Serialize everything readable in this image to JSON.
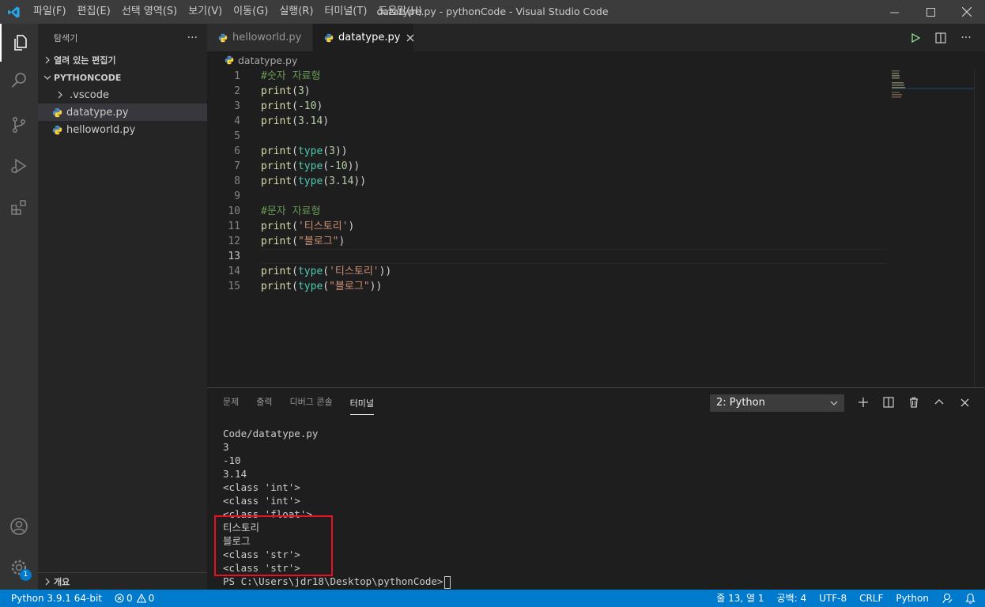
{
  "window": {
    "title": "datatype.py - pythonCode - Visual Studio Code"
  },
  "menu": [
    "파일(F)",
    "편집(E)",
    "선택 영역(S)",
    "보기(V)",
    "이동(G)",
    "실행(R)",
    "터미널(T)",
    "도움말(H)"
  ],
  "sidebar": {
    "title": "탐색기",
    "more": "···",
    "open_editors": "열려 있는 편집기",
    "folder": "PYTHONCODE",
    "items": [
      {
        "label": ".vscode",
        "type": "folder"
      },
      {
        "label": "datatype.py",
        "type": "python",
        "selected": true
      },
      {
        "label": "helloworld.py",
        "type": "python"
      }
    ],
    "outline": "개요"
  },
  "tabs": [
    {
      "label": "helloworld.py",
      "active": false
    },
    {
      "label": "datatype.py",
      "active": true
    }
  ],
  "breadcrumb": "datatype.py",
  "editor": {
    "current_line": 13,
    "lines": [
      {
        "n": "1",
        "tokens": [
          {
            "t": "#숫자 자료형",
            "c": "cm"
          }
        ]
      },
      {
        "n": "2",
        "tokens": [
          {
            "t": "print",
            "c": "fn"
          },
          {
            "t": "(",
            "c": "p"
          },
          {
            "t": "3",
            "c": "num"
          },
          {
            "t": ")",
            "c": "p"
          }
        ]
      },
      {
        "n": "3",
        "tokens": [
          {
            "t": "print",
            "c": "fn"
          },
          {
            "t": "(-",
            "c": "p"
          },
          {
            "t": "10",
            "c": "num"
          },
          {
            "t": ")",
            "c": "p"
          }
        ]
      },
      {
        "n": "4",
        "tokens": [
          {
            "t": "print",
            "c": "fn"
          },
          {
            "t": "(",
            "c": "p"
          },
          {
            "t": "3.14",
            "c": "num"
          },
          {
            "t": ")",
            "c": "p"
          }
        ]
      },
      {
        "n": "5",
        "tokens": []
      },
      {
        "n": "6",
        "tokens": [
          {
            "t": "print",
            "c": "fn"
          },
          {
            "t": "(",
            "c": "p"
          },
          {
            "t": "type",
            "c": "bi"
          },
          {
            "t": "(",
            "c": "p"
          },
          {
            "t": "3",
            "c": "num"
          },
          {
            "t": "))",
            "c": "p"
          }
        ]
      },
      {
        "n": "7",
        "tokens": [
          {
            "t": "print",
            "c": "fn"
          },
          {
            "t": "(",
            "c": "p"
          },
          {
            "t": "type",
            "c": "bi"
          },
          {
            "t": "(-",
            "c": "p"
          },
          {
            "t": "10",
            "c": "num"
          },
          {
            "t": "))",
            "c": "p"
          }
        ]
      },
      {
        "n": "8",
        "tokens": [
          {
            "t": "print",
            "c": "fn"
          },
          {
            "t": "(",
            "c": "p"
          },
          {
            "t": "type",
            "c": "bi"
          },
          {
            "t": "(",
            "c": "p"
          },
          {
            "t": "3.14",
            "c": "num"
          },
          {
            "t": "))",
            "c": "p"
          }
        ]
      },
      {
        "n": "9",
        "tokens": []
      },
      {
        "n": "10",
        "tokens": [
          {
            "t": "#문자 자료형",
            "c": "cm"
          }
        ]
      },
      {
        "n": "11",
        "tokens": [
          {
            "t": "print",
            "c": "fn"
          },
          {
            "t": "(",
            "c": "p"
          },
          {
            "t": "'티스토리'",
            "c": "str"
          },
          {
            "t": ")",
            "c": "p"
          }
        ]
      },
      {
        "n": "12",
        "tokens": [
          {
            "t": "print",
            "c": "fn"
          },
          {
            "t": "(",
            "c": "p"
          },
          {
            "t": "\"블로그\"",
            "c": "str"
          },
          {
            "t": ")",
            "c": "p"
          }
        ]
      },
      {
        "n": "13",
        "tokens": []
      },
      {
        "n": "14",
        "tokens": [
          {
            "t": "print",
            "c": "fn"
          },
          {
            "t": "(",
            "c": "p"
          },
          {
            "t": "type",
            "c": "bi"
          },
          {
            "t": "(",
            "c": "p"
          },
          {
            "t": "'티스토리'",
            "c": "str"
          },
          {
            "t": "))",
            "c": "p"
          }
        ]
      },
      {
        "n": "15",
        "tokens": [
          {
            "t": "print",
            "c": "fn"
          },
          {
            "t": "(",
            "c": "p"
          },
          {
            "t": "type",
            "c": "bi"
          },
          {
            "t": "(",
            "c": "p"
          },
          {
            "t": "\"블로그\"",
            "c": "str"
          },
          {
            "t": "))",
            "c": "p"
          }
        ]
      }
    ]
  },
  "panel": {
    "tabs": [
      {
        "label": "문제",
        "active": false
      },
      {
        "label": "출력",
        "active": false
      },
      {
        "label": "디버그 콘솔",
        "active": false
      },
      {
        "label": "터미널",
        "active": true
      }
    ],
    "terminal_select": "2: Python",
    "terminal_lines": [
      "Code/datatype.py",
      "3",
      "-10",
      "3.14",
      "<class 'int'>",
      "<class 'int'>",
      "<class 'float'>",
      "티스토리",
      "블로그",
      "<class 'str'>",
      "<class 'str'>"
    ],
    "prompt": "PS C:\\Users\\jdr18\\Desktop\\pythonCode>"
  },
  "statusbar": {
    "python": "Python 3.9.1 64-bit",
    "errors": "0",
    "warnings": "0",
    "position": "줄 13, 열 1",
    "spaces": "공백: 4",
    "encoding": "UTF-8",
    "eol": "CRLF",
    "language": "Python"
  },
  "badges": {
    "settings": "1"
  },
  "colors": {
    "accent": "#007acc",
    "highlight": "#e81123"
  }
}
